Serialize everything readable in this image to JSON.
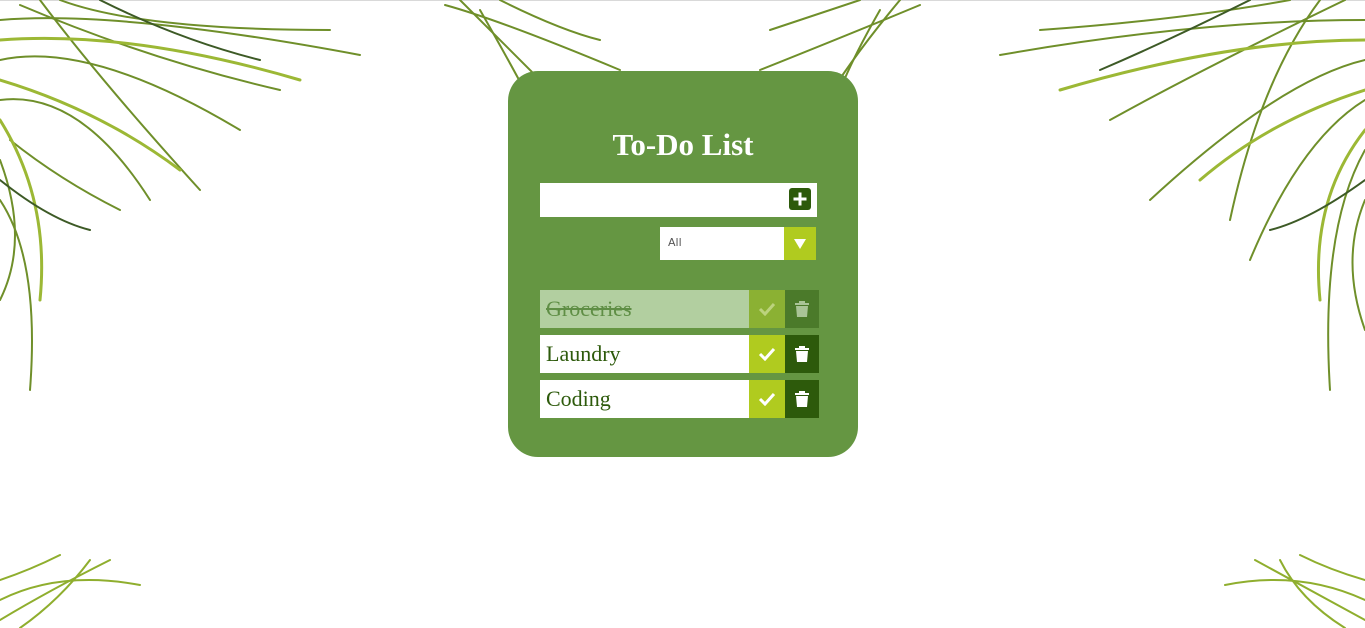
{
  "app": {
    "title": "To-Do List"
  },
  "input": {
    "value": "",
    "placeholder": ""
  },
  "filter": {
    "selected": "All"
  },
  "todos": [
    {
      "label": "Groceries",
      "completed": true
    },
    {
      "label": "Laundry",
      "completed": false
    },
    {
      "label": "Coding",
      "completed": false
    }
  ],
  "icons": {
    "add": "plus-square-icon",
    "dropdown": "caret-down-icon",
    "check": "check-icon",
    "delete": "trash-icon"
  },
  "colors": {
    "card": "#659642",
    "accent": "#b0cb1f",
    "dark_green": "#2d5a0b",
    "text": "#ffffff"
  }
}
